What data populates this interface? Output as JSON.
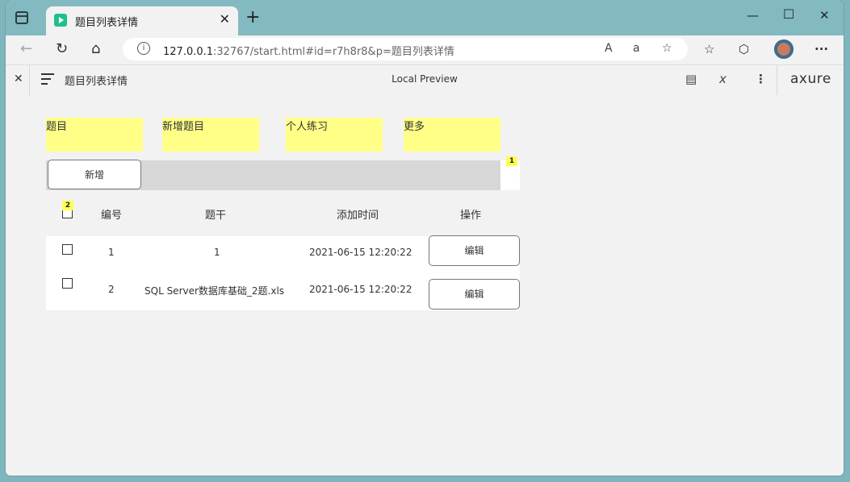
{
  "browser": {
    "tab_title": "题目列表详情",
    "url_host": "127.0.0.1",
    "url_rest": ":32767/start.html#id=r7h8r8&p=题目列表详情",
    "close_symbol": "✕",
    "newtab_symbol": "+"
  },
  "axure": {
    "page_title": "题目列表详情",
    "preview_label": "Local Preview",
    "logo": "axure"
  },
  "nav_stickies": [
    "题目",
    "新增题目",
    "个人练习",
    "更多"
  ],
  "toolbar": {
    "add_label": "新增"
  },
  "badges": {
    "one": "1",
    "two": "2"
  },
  "table": {
    "headers": [
      "编号",
      "题干",
      "添加时间",
      "操作"
    ],
    "rows": [
      {
        "id": "1",
        "stem": "1",
        "time": "2021-06-15 12:20:22",
        "action": "编辑"
      },
      {
        "id": "2",
        "stem": "SQL Server数据库基础_2题.xls",
        "time": "2021-06-15 12:20:22",
        "action": "编辑"
      }
    ]
  }
}
